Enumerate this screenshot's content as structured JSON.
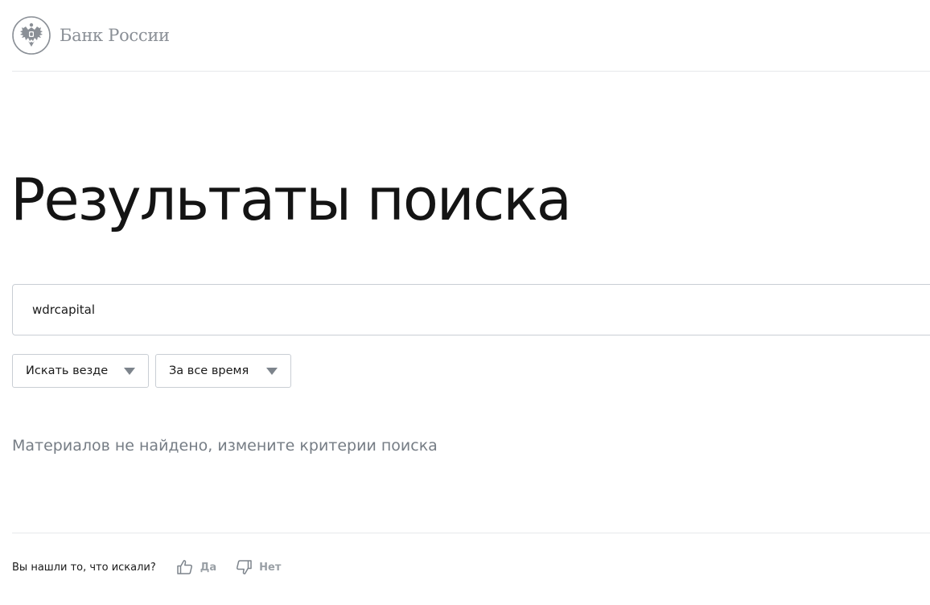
{
  "header": {
    "logo_text": "Банк России"
  },
  "main": {
    "title": "Результаты поиска",
    "search": {
      "value": "wdrcapital"
    },
    "filters": [
      {
        "label": "Искать везде",
        "icon": "chevron-down-icon"
      },
      {
        "label": "За все время",
        "icon": "chevron-down-icon"
      }
    ],
    "empty_message": "Материалов не найдено, измените критерии поиска"
  },
  "feedback": {
    "question": "Вы нашли то, что искали?",
    "yes": {
      "label": "Да",
      "icon": "thumbs-up-icon"
    },
    "no": {
      "label": "Нет",
      "icon": "thumbs-down-icon"
    }
  },
  "colors": {
    "text": "#1a1a1a",
    "muted": "#767d85",
    "logo": "#8a8f96",
    "border": "#c9ced4",
    "divider": "#e6e8eb"
  }
}
